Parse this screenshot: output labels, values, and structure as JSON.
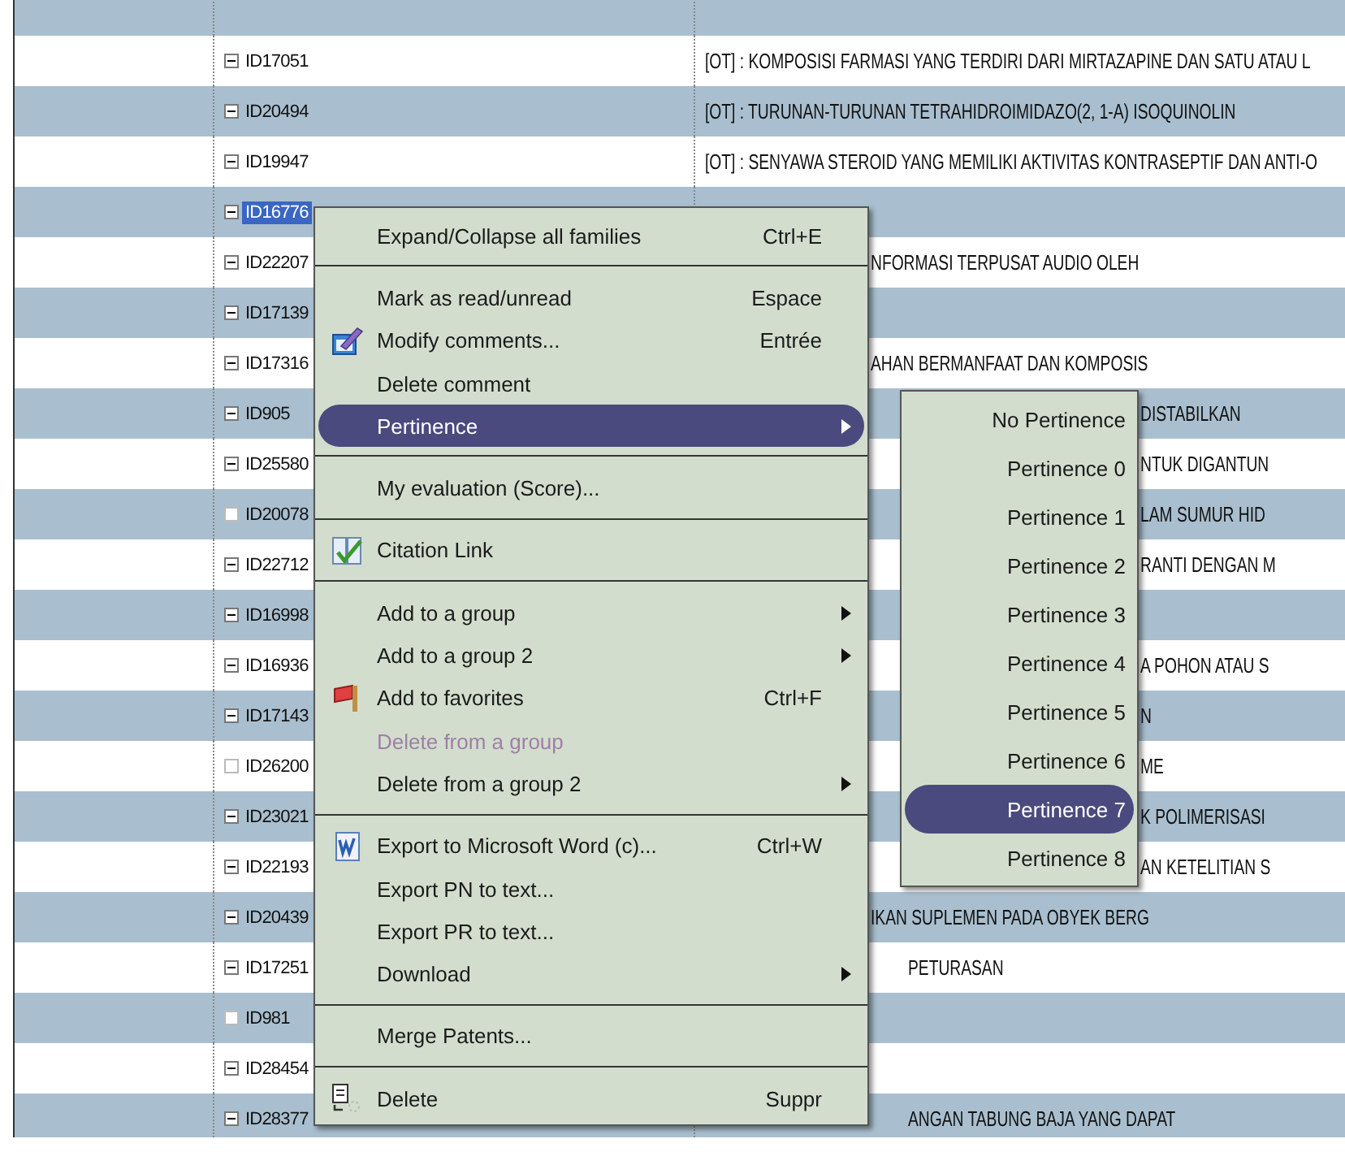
{
  "rows": [
    {
      "id": "ID17051",
      "title": "[OT] : KOMPOSISI FARMASI YANG TERDIRI DARI MIRTAZAPINE DAN SATU ATAU L",
      "kind": "plain",
      "selected": false,
      "empty": false
    },
    {
      "id": "ID20494",
      "title": "[OT] : TURUNAN-TURUNAN TETRAHIDROIMIDAZO(2, 1-A) ISOQUINOLIN",
      "kind": "plain",
      "selected": false,
      "empty": false
    },
    {
      "id": "ID19947",
      "title": "[OT] : SENYAWA STEROID YANG MEMILIKI AKTIVITAS KONTRASEPTIF DAN ANTI-O",
      "kind": "plain",
      "selected": false,
      "empty": false
    },
    {
      "id": "ID16776",
      "selected": true,
      "empty": false
    },
    {
      "id": "ID22207",
      "title": "NFORMASI TERPUSAT AUDIO OLEH",
      "kind": "after_menu",
      "selected": false,
      "empty": false
    },
    {
      "id": "ID17139",
      "selected": false,
      "empty": false
    },
    {
      "id": "ID17316",
      "title": "AHAN BERMANFAAT DAN KOMPOSIS",
      "kind": "after_menu",
      "selected": false,
      "empty": false
    },
    {
      "id": "ID905",
      "title": "DISTABILKAN",
      "kind": "after_submenu",
      "selected": false,
      "empty": false
    },
    {
      "id": "ID25580",
      "title": "NTUK DIGANTUN",
      "kind": "after_submenu",
      "selected": false,
      "empty": false
    },
    {
      "id": "ID20078",
      "title": "LAM SUMUR HID",
      "kind": "after_submenu",
      "selected": false,
      "empty": true
    },
    {
      "id": "ID22712",
      "title": "RANTI DENGAN M",
      "kind": "after_submenu",
      "selected": false,
      "empty": false
    },
    {
      "id": "ID16998",
      "selected": false,
      "empty": false
    },
    {
      "id": "ID16936",
      "title": "A POHON ATAU S",
      "kind": "after_submenu",
      "selected": false,
      "empty": false
    },
    {
      "id": "ID17143",
      "title": "N",
      "kind": "after_submenu",
      "selected": false,
      "empty": false
    },
    {
      "id": "ID26200",
      "title": "ME",
      "kind": "after_submenu",
      "selected": false,
      "empty": true
    },
    {
      "id": "ID23021",
      "title": "K POLIMERISASI",
      "kind": "after_submenu",
      "selected": false,
      "empty": false
    },
    {
      "id": "ID22193",
      "title": "AN KETELITIAN S",
      "kind": "after_submenu",
      "selected": false,
      "empty": false
    },
    {
      "id": "ID20439",
      "title": "IKAN SUPLEMEN PADA OBYEK BERG",
      "kind": "after_menu",
      "selected": false,
      "empty": false
    },
    {
      "id": "ID17251",
      "title": "PETURASAN",
      "kind": "after_menu_wide",
      "selected": false,
      "empty": false
    },
    {
      "id": "ID981",
      "selected": false,
      "empty": true
    },
    {
      "id": "ID28454",
      "selected": false,
      "empty": false
    },
    {
      "id": "ID28377",
      "title": "ANGAN TABUNG BAJA YANG DAPAT",
      "kind": "after_menu_wide",
      "selected": false,
      "empty": false
    }
  ],
  "context_menu": [
    {
      "kind": "item",
      "label": "Expand/Collapse all families",
      "shortcut": "Ctrl+E",
      "submenu": false,
      "disabled": false,
      "selected": false,
      "icon": false
    },
    {
      "kind": "separator"
    },
    {
      "kind": "item",
      "label": "Mark as read/unread",
      "shortcut": "Espace",
      "submenu": false,
      "disabled": false,
      "selected": false,
      "icon": false
    },
    {
      "kind": "item",
      "label": "Modify comments...",
      "shortcut": "Entrée",
      "submenu": false,
      "disabled": false,
      "selected": false,
      "icon": true
    },
    {
      "kind": "item",
      "label": "Delete comment",
      "submenu": false,
      "disabled": false,
      "selected": false,
      "icon": false
    },
    {
      "kind": "item",
      "label": "Pertinence",
      "submenu": true,
      "disabled": false,
      "selected": true,
      "icon": false
    },
    {
      "kind": "separator"
    },
    {
      "kind": "item",
      "label": "My evaluation (Score)...",
      "submenu": false,
      "disabled": false,
      "selected": false,
      "icon": false
    },
    {
      "kind": "separator"
    },
    {
      "kind": "item",
      "label": "Citation Link",
      "submenu": false,
      "disabled": false,
      "selected": false,
      "icon": true
    },
    {
      "kind": "separator"
    },
    {
      "kind": "item",
      "label": "Add to a group",
      "submenu": true,
      "disabled": false,
      "selected": false,
      "icon": false
    },
    {
      "kind": "item",
      "label": "Add to a group 2",
      "submenu": true,
      "disabled": false,
      "selected": false,
      "icon": false
    },
    {
      "kind": "item",
      "label": "Add to favorites",
      "shortcut": "Ctrl+F",
      "submenu": false,
      "disabled": false,
      "selected": false,
      "icon": true
    },
    {
      "kind": "item",
      "label": "Delete from a group",
      "submenu": false,
      "disabled": true,
      "selected": false,
      "icon": false
    },
    {
      "kind": "item",
      "label": "Delete from a group 2",
      "submenu": true,
      "disabled": false,
      "selected": false,
      "icon": false
    },
    {
      "kind": "separator"
    },
    {
      "kind": "item",
      "label": "Export to Microsoft Word (c)...",
      "shortcut": "Ctrl+W",
      "submenu": false,
      "disabled": false,
      "selected": false,
      "icon": true
    },
    {
      "kind": "item",
      "label": "Export PN to text...",
      "submenu": false,
      "disabled": false,
      "selected": false,
      "icon": false
    },
    {
      "kind": "item",
      "label": "Export PR to text...",
      "submenu": false,
      "disabled": false,
      "selected": false,
      "icon": false
    },
    {
      "kind": "item",
      "label": "Download",
      "submenu": true,
      "disabled": false,
      "selected": false,
      "icon": false
    },
    {
      "kind": "separator"
    },
    {
      "kind": "item",
      "label": "Merge Patents...",
      "submenu": false,
      "disabled": false,
      "selected": false,
      "icon": false
    },
    {
      "kind": "separator"
    },
    {
      "kind": "item",
      "label": "Delete",
      "shortcut": "Suppr",
      "submenu": false,
      "disabled": false,
      "selected": false,
      "icon": true
    }
  ],
  "submenu": [
    {
      "label": "No Pertinence",
      "selected": false
    },
    {
      "label": "Pertinence 0",
      "selected": false
    },
    {
      "label": "Pertinence 1",
      "selected": false
    },
    {
      "label": "Pertinence 2",
      "selected": false
    },
    {
      "label": "Pertinence 3",
      "selected": false
    },
    {
      "label": "Pertinence 4",
      "selected": false
    },
    {
      "label": "Pertinence 5",
      "selected": false
    },
    {
      "label": "Pertinence 6",
      "selected": false
    },
    {
      "label": "Pertinence 7",
      "selected": true
    },
    {
      "label": "Pertinence 8",
      "selected": false
    }
  ]
}
